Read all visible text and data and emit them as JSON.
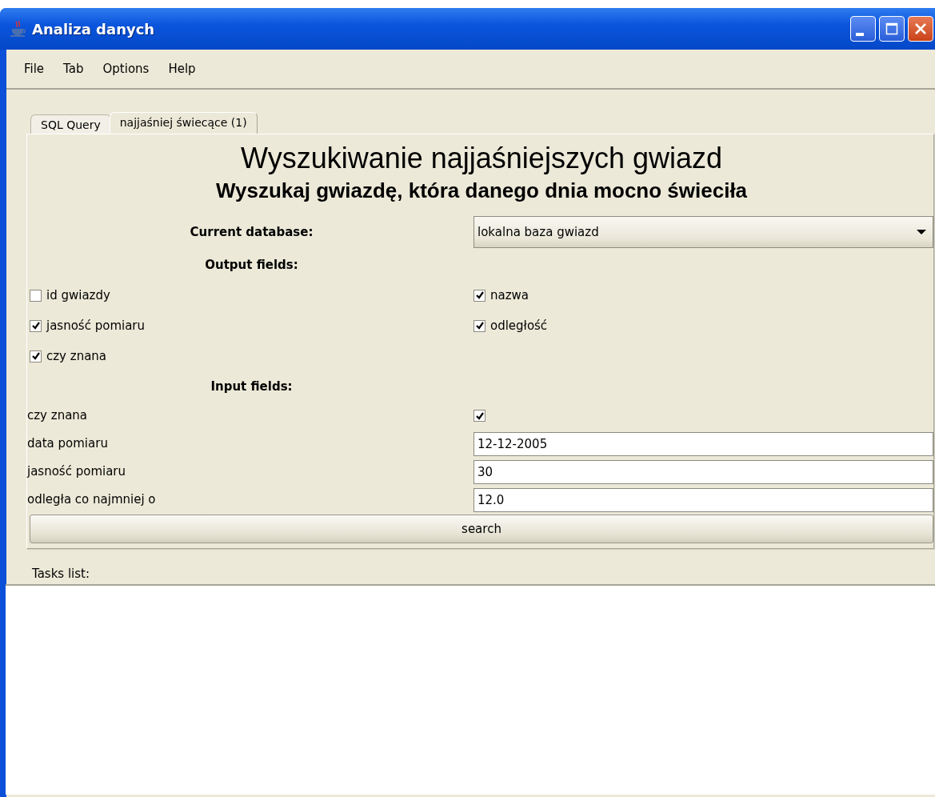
{
  "window": {
    "title": "Analiza danych"
  },
  "menu": [
    "File",
    "Tab",
    "Options",
    "Help"
  ],
  "tabs": [
    {
      "label": "SQL Query",
      "selected": false
    },
    {
      "label": "najjaśniej świecące (1)",
      "selected": true
    }
  ],
  "heading": "Wyszukiwanie najjaśniejszych gwiazd",
  "subheading": "Wyszukaj gwiazdę, która danego dnia mocno świeciła",
  "database": {
    "label": "Current database:",
    "value": "lokalna baza gwiazd"
  },
  "output_fields": {
    "label": "Output fields:",
    "items": [
      {
        "label": "id gwiazdy",
        "checked": false
      },
      {
        "label": "nazwa",
        "checked": true
      },
      {
        "label": "jasność pomiaru",
        "checked": true
      },
      {
        "label": "odległość",
        "checked": true
      },
      {
        "label": "czy znana",
        "checked": true
      }
    ]
  },
  "input_fields": {
    "label": "Input fields:",
    "items": [
      {
        "kind": "checkbox",
        "label": "czy znana",
        "checked": true
      },
      {
        "kind": "text",
        "label": "data pomiaru",
        "value": "12-12-2005"
      },
      {
        "kind": "text",
        "label": "jasność pomiaru",
        "value": "30"
      },
      {
        "kind": "text",
        "label": "odległa co najmniej o",
        "value": "12.0"
      }
    ]
  },
  "search_button": "search",
  "tasks": {
    "label": "Tasks list:"
  }
}
